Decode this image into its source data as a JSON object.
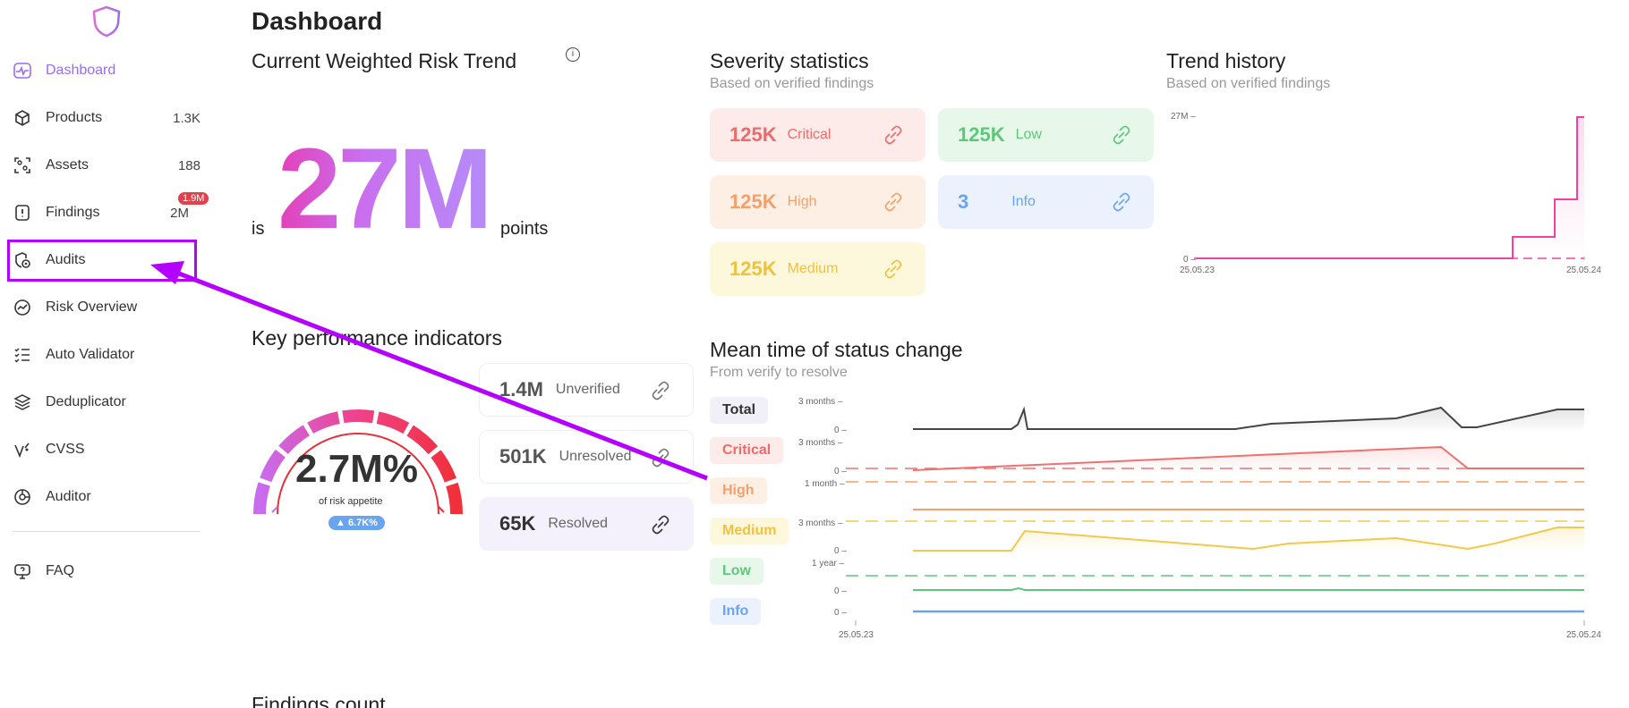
{
  "sidebar": {
    "items": [
      {
        "label": "Dashboard",
        "icon": "pulse-icon",
        "count": ""
      },
      {
        "label": "Products",
        "icon": "cube-icon",
        "count": "1.3K"
      },
      {
        "label": "Assets",
        "icon": "scan-icon",
        "count": "188"
      },
      {
        "label": "Findings",
        "icon": "alert-file-icon",
        "count": "2M",
        "badge": "1.9M"
      },
      {
        "label": "Audits",
        "icon": "audit-icon",
        "count": ""
      },
      {
        "label": "Risk Overview",
        "icon": "chart-circle-icon",
        "count": ""
      },
      {
        "label": "Auto Validator",
        "icon": "checklist-icon",
        "count": ""
      },
      {
        "label": "Deduplicator",
        "icon": "layers-icon",
        "count": ""
      },
      {
        "label": "CVSS",
        "icon": "cvss-icon",
        "count": ""
      },
      {
        "label": "Auditor",
        "icon": "auditor-icon",
        "count": ""
      },
      {
        "label": "FAQ",
        "icon": "help-monitor-icon",
        "count": ""
      }
    ]
  },
  "page": {
    "title": "Dashboard"
  },
  "risk_trend": {
    "title": "Current Weighted Risk Trend",
    "prefix": "is",
    "value": "27M",
    "suffix": "points"
  },
  "severity": {
    "title": "Severity statistics",
    "subtitle": "Based on verified findings",
    "tiles": [
      {
        "value": "125K",
        "label": "Critical"
      },
      {
        "value": "125K",
        "label": "Low"
      },
      {
        "value": "125K",
        "label": "High"
      },
      {
        "value": "3",
        "label": "Info"
      },
      {
        "value": "125K",
        "label": "Medium"
      }
    ]
  },
  "trend_history": {
    "title": "Trend history",
    "subtitle": "Based on verified findings",
    "y_labels": [
      "27M –",
      "0 –"
    ],
    "x_labels": [
      "25.05.23",
      "25.05.24"
    ]
  },
  "kpi": {
    "title": "Key performance indicators",
    "gauge_value": "2.7M%",
    "gauge_caption": "of risk appetite",
    "gauge_delta": "▲ 6.7K%",
    "cards": [
      {
        "value": "1.4M",
        "label": "Unverified"
      },
      {
        "value": "501K",
        "label": "Unresolved"
      },
      {
        "value": "65K",
        "label": "Resolved"
      }
    ]
  },
  "mean_time": {
    "title": "Mean time of status change",
    "subtitle": "From verify to resolve",
    "legend": [
      "Total",
      "Critical",
      "High",
      "Medium",
      "Low",
      "Info"
    ],
    "y_labels": [
      "3 months –",
      "0 –",
      "3 months –",
      "0 –",
      "1 month –",
      "3 months –",
      "0 –",
      "1 year –",
      "0 –",
      "0 –"
    ],
    "x_labels": [
      "25.05.23",
      "25.05.24"
    ]
  },
  "findings_count": {
    "title": "Findings count"
  },
  "colors": {
    "accent": "#9b6cf0",
    "critical": "#f07070",
    "high": "#f5a06a",
    "medium": "#f2c94c",
    "low": "#5ec87a",
    "info": "#6aa4ef",
    "annotation": "#b400ff"
  }
}
